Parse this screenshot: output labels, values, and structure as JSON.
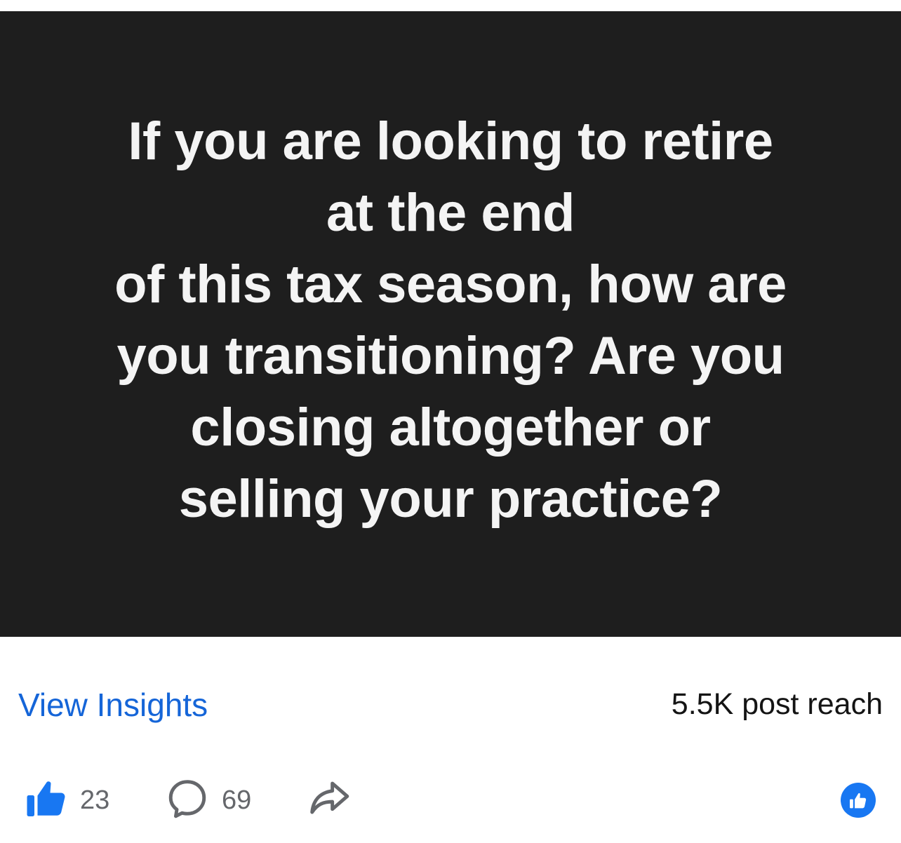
{
  "post": {
    "text": "If you are looking to retire\nat the end\nof this tax season, how are\nyou transitioning? Are you\nclosing altogether or\nselling your practice?"
  },
  "insights": {
    "link_label": "View Insights",
    "reach_label": "5.5K post reach"
  },
  "actions": {
    "like_icon": "thumbs-up-icon",
    "like_count": "23",
    "comment_icon": "speech-bubble-icon",
    "comment_count": "69",
    "share_icon": "share-arrow-icon",
    "reaction_badge_icon": "thumbs-up-badge-icon"
  },
  "colors": {
    "image_background": "#1e1e1e",
    "link_blue": "#1565d8",
    "like_blue": "#1877f2",
    "muted_gray": "#65676b"
  }
}
